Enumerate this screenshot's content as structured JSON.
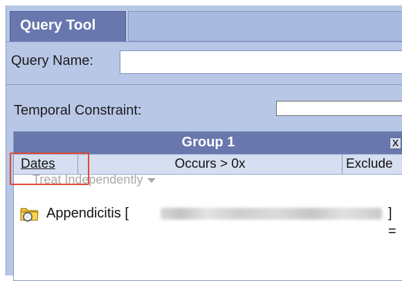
{
  "tab": {
    "title": "Query Tool"
  },
  "query_name": {
    "label": "Query Name:",
    "value": "",
    "placeholder": ""
  },
  "temporal": {
    "label": "Temporal Constraint:",
    "value": ""
  },
  "group": {
    "title": "Group 1",
    "close_label": "X",
    "dates_label": "Dates",
    "occurs_label": "Occurs > 0x",
    "exclude_label": "Exclude",
    "treat_label": "Treat Independently",
    "items": [
      {
        "label": "Appendicitis [",
        "suffix": "] =",
        "icon": "folder-icon"
      }
    ]
  },
  "colors": {
    "panel_bg": "#b9c7e7",
    "header_blue": "#6877ad",
    "toolbar_bg": "#d6def1",
    "highlight_red": "#e0482f"
  }
}
